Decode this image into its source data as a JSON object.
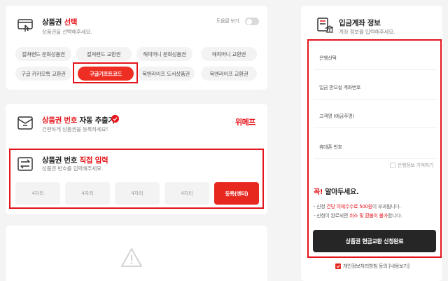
{
  "select_panel": {
    "title_prefix": "상품권 ",
    "title_accent": "선택",
    "subtitle": "상품권을 선택해주세요.",
    "help_label": "도움말 보기",
    "help_toggle_on": false,
    "chips": [
      "컬쳐랜드 문화상품권",
      "컬쳐랜드 교환권",
      "해피머니 문화상품권",
      "해피머니 교환권",
      "구글 카카오톡 교환권",
      "구글기프트코드",
      "북앤라이프 도서상품권",
      "북앤라이프 교환권"
    ],
    "selected_chip": "구글기프트코드"
  },
  "auto_panel": {
    "title_accent": "상품권 번호",
    "title_rest": " 자동 추출기",
    "subtitle": "간편하게 상품권을 등록하세요!",
    "brand": "위메프"
  },
  "direct_panel": {
    "title_prefix": "상품권 번호 ",
    "title_accent": "직접 입력",
    "subtitle": "상품권 번호를 입력해주세요.",
    "digit_fields": [
      "4자리",
      "4자리",
      "4자리",
      "4자리"
    ],
    "submit_label": "등록(엔터)"
  },
  "account_panel": {
    "title": "입금계좌 정보",
    "subtitle": "계좌 정보를 입력해주세요.",
    "fields": [
      "은행선택",
      "입금 받으실 계좌번호",
      "고객명 (예금주명)",
      "휴대폰 번호"
    ],
    "remember_label": "은행정보 기억하기",
    "notice_accent": "꼭!",
    "notice_rest": " 알아두세요.",
    "notices": [
      {
        "pre": "- 신청 ",
        "accent": "건당 이체수수료 500원",
        "post": "이 부과됩니다."
      },
      {
        "pre": "- 신청이 완료되면 ",
        "accent": "취소 및 환불이 불가",
        "post": "합니다."
      }
    ],
    "submit_label": "상품권 현금교환 신청완료",
    "consent_label": "개인정보처리방침 동의 [내용보기]",
    "consent_checked": true
  },
  "colors": {
    "accent": "#e4141a",
    "dark_button": "#262626"
  }
}
